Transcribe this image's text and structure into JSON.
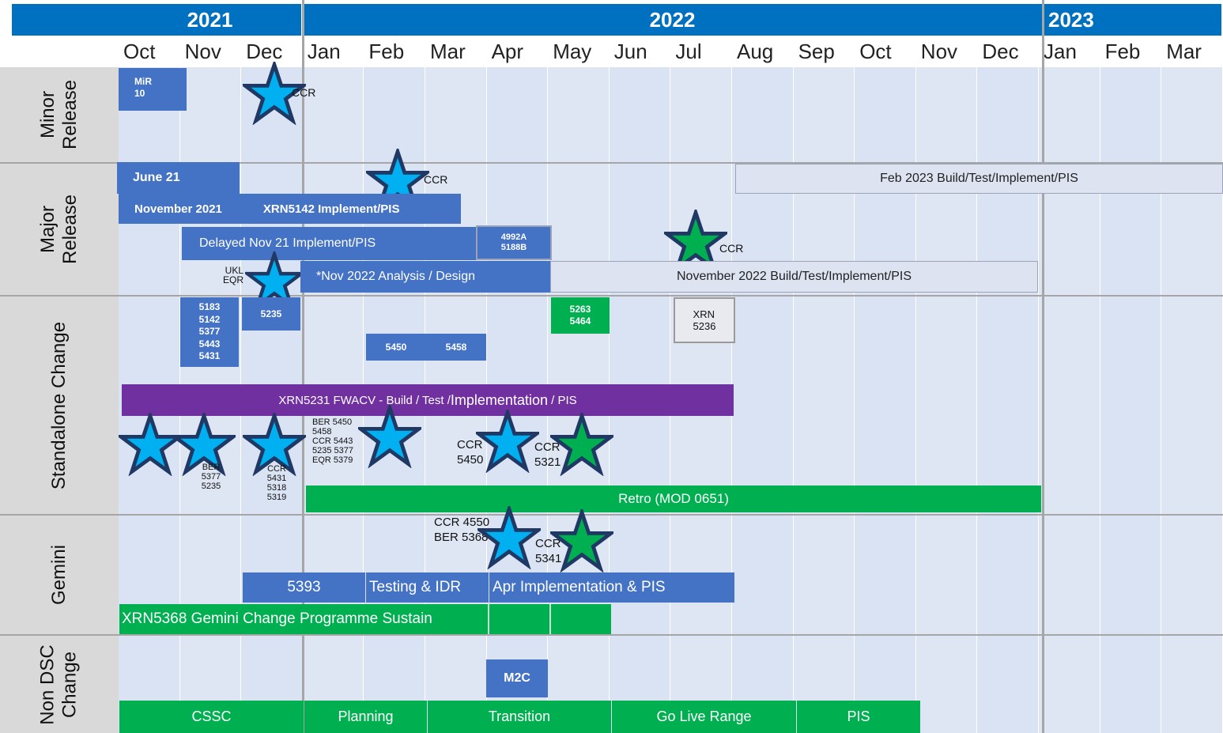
{
  "years": [
    "2021",
    "2022",
    "2023"
  ],
  "months": [
    "Oct",
    "Nov",
    "Dec",
    "Jan",
    "Feb",
    "Mar",
    "Apr",
    "May",
    "Jun",
    "Jul",
    "Aug",
    "Sep",
    "Oct",
    "Nov",
    "Dec",
    "Jan",
    "Feb",
    "Mar"
  ],
  "rows": {
    "minor": "Minor\nRelease",
    "major": "Major\nRelease",
    "standalone": "Standalone Change",
    "gemini": "Gemini",
    "nondsc": "Non DSC\nChange"
  },
  "minor": {
    "mir10": "MiR\n10",
    "ccr": "CCR"
  },
  "major": {
    "june21": "June 21",
    "ccr_feb": "CCR",
    "feb2023": "Feb 2023 Build/Test/Implement/PIS",
    "nov2021": "November 2021",
    "xrn5142": "XRN5142 Implement/PIS",
    "delayed": "Delayed Nov 21 Implement/PIS",
    "box4992": "4992A\n5188B",
    "ccr_jul": "CCR",
    "ukl": "UKL\nEQR",
    "nov2022_analysis": "*Nov 2022 Analysis / Design",
    "nov2022_build": "November 2022 Build/Test/Implement/PIS"
  },
  "standalone": {
    "nov_list": "5183\n5142\n5377\n5443\n5431",
    "b5235": "5235",
    "b5263": "5263\n5464",
    "xrn5236": "XRN\n5236",
    "b5450": "5450",
    "b5458": "5458",
    "fwacv_a": "XRN5231 FWACV - Build / Test / ",
    "fwacv_b": "Implementation",
    "fwacv_c": " / PIS",
    "ber_nov": "BER\n5377\n5235",
    "ccr_dec": "CCR\n5431\n5318\n5319",
    "ber_jan": "BER 5450\n5458\nCCR 5443\n5235 5377\nEQR 5379",
    "ccr5450": "CCR\n5450",
    "ccr5321": "CCR\n5321",
    "retro": "Retro (MOD 0651)"
  },
  "gemini": {
    "ccr4550": "CCR 4550\nBER 5368",
    "ccr5341": "CCR\n5341",
    "b5393": "5393",
    "testing": "Testing & IDR",
    "apr_impl": "Apr Implementation & PIS",
    "xrn5368": "XRN5368 Gemini Change Programme Sustain"
  },
  "nondsc": {
    "m2c": "M2C",
    "cssc": "CSSC",
    "planning": "Planning",
    "transition": "Transition",
    "golive": "Go Live Range",
    "pis": "PIS"
  },
  "colors": {
    "year_blue": "#0070c0",
    "bar_blue": "#4472c4",
    "green": "#00b050",
    "purple": "#7030a0",
    "star_blue": "#00b0f0",
    "star_green": "#00b050",
    "star_outline": "#203864"
  }
}
